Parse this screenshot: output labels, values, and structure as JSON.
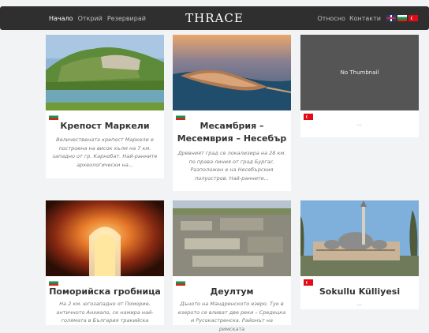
{
  "nav": {
    "links": [
      "Начало",
      "Открий",
      "Резервирай"
    ],
    "brand": "THRACE",
    "right_links": [
      "Относно",
      "Контакти"
    ]
  },
  "cards": [
    {
      "title": "Крепост Маркели",
      "flag": "bg",
      "description": "Величествената крепост Маркели е построена на висок хълм на 7 км. западно от гр. Карнобат. Най-ранните археологически на..."
    },
    {
      "title": "Месамбрия – Месемврия – Несебър",
      "flag": "bg",
      "description": "Древният град се локализира на 28 км. по права линия от град Бургас. Разположен е на Несебърския полуостров. Най-ранните..."
    },
    {
      "title": "",
      "flag": "tr",
      "thumbnail_text": "No Thumbnail",
      "description": "..."
    },
    {
      "title": "Поморийска гробница",
      "flag": "bg",
      "description": "На 2 км. югозападно от Поморие, античното Анхиало, се намира най-голямата в България тракийска"
    },
    {
      "title": "Деултум",
      "flag": "bg",
      "description": "Дъното на Мандренското езеро. Тук в езерото се вливат две реки – Средецка и Русокастренска. Районът на римската"
    },
    {
      "title": "Sokullu Külliyesi",
      "flag": "tr",
      "description": "..."
    }
  ]
}
